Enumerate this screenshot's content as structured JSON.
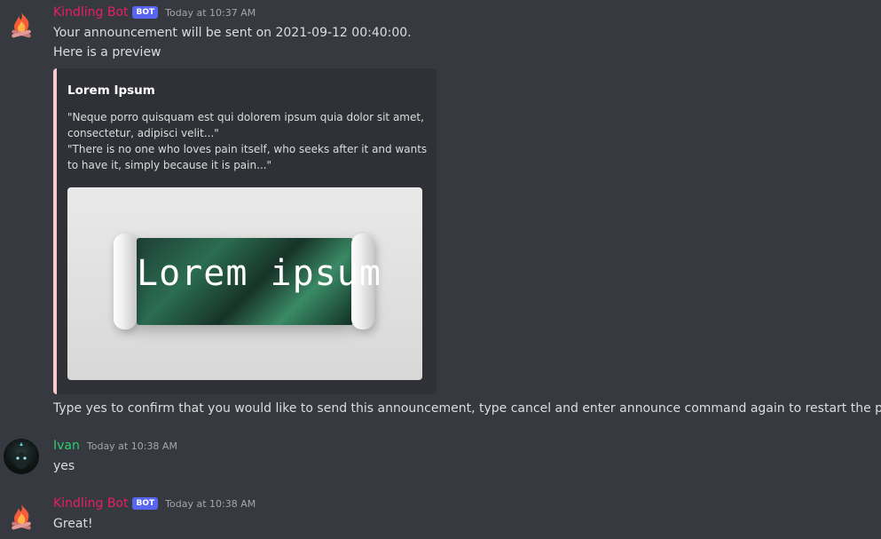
{
  "messages": [
    {
      "author": "Kindling Bot",
      "bot_tag": "BOT",
      "timestamp": "Today at 10:37 AM",
      "lines": [
        "Your announcement will be sent on 2021-09-12 00:40:00.",
        "Here is a preview"
      ],
      "embed": {
        "title": "Lorem Ipsum",
        "description": [
          "\"Neque porro quisquam est qui dolorem ipsum quia dolor sit amet,",
          "consectetur, adipisci velit...\"",
          "\"There is no one who loves pain itself, who seeks after it and wants",
          "to have it, simply because it is pain...\""
        ],
        "image_text": "Lorem ipsum"
      },
      "followup": "Type yes to confirm that you would like to send this announcement, type cancel and enter announce command again to restart the process"
    },
    {
      "author": "Ivan",
      "timestamp": "Today at 10:38 AM",
      "text": "yes"
    },
    {
      "author": "Kindling Bot",
      "bot_tag": "BOT",
      "timestamp": "Today at 10:38 AM",
      "text": "Great!"
    }
  ],
  "colors": {
    "background": "#36393f",
    "bot_name": "#e91e63",
    "user_name": "#2ecc71",
    "bot_tag": "#5865f2",
    "embed_accent": "#f8c9cf"
  },
  "icons": {
    "bot_avatar": "campfire-icon",
    "user_avatar": "wolf-avatar"
  }
}
